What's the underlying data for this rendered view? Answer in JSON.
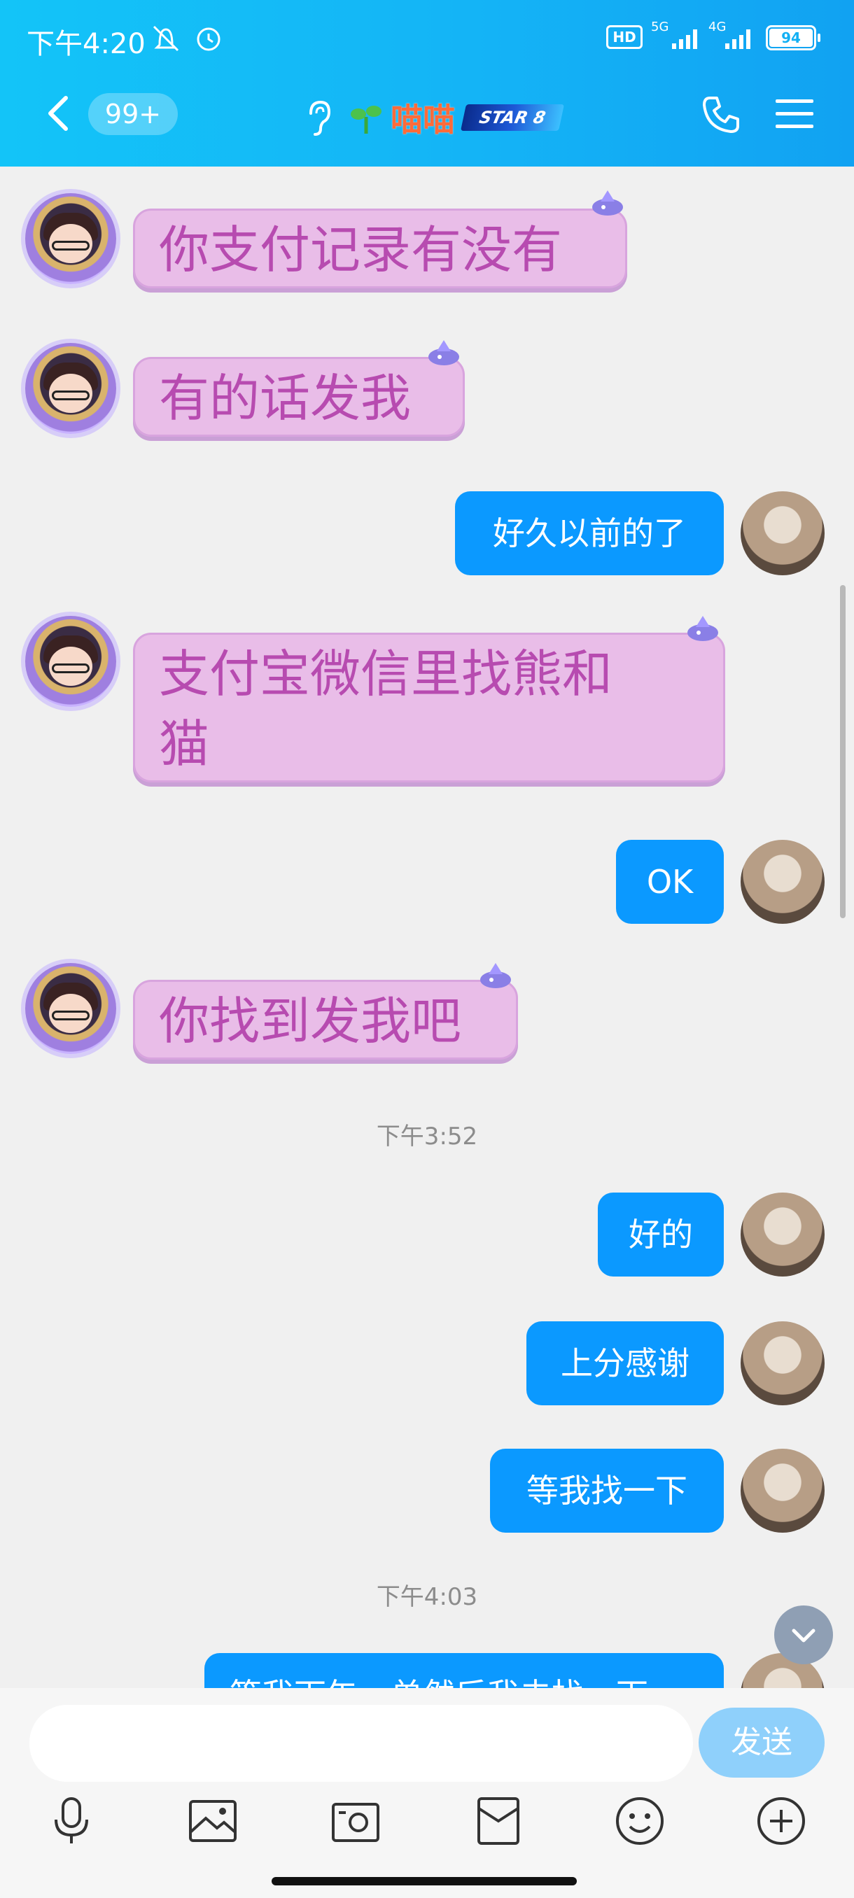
{
  "status_bar": {
    "time": "下午4:20",
    "network_5g": "5G",
    "network_4g": "4G",
    "hd": "HD",
    "battery": "94"
  },
  "header": {
    "unread_badge": "99+",
    "contact_name": "喵喵",
    "level_badge": "STAR 8"
  },
  "messages": {
    "m1": "你支付记录有没有",
    "m2": "有的话发我",
    "m3": "好久以前的了",
    "m4_line1": "支付宝微信里找熊和",
    "m4_line2": "猫",
    "m5": "OK",
    "m6": "你找到发我吧",
    "t1": "下午3:52",
    "m7": "好的",
    "m8": "上分感谢",
    "m9": "等我找一下",
    "t2": "下午4:03",
    "m10": "等我下午，单然后我去找一下"
  },
  "input": {
    "placeholder": "",
    "send_label": "发送"
  },
  "colors": {
    "header": "#13c4f8",
    "bubble_blue": "#0b99ff",
    "bubble_pink": "#e9bde8",
    "pink_text": "#b74bb0"
  },
  "icons": [
    "back-icon",
    "ear-icon",
    "sprout-icon",
    "phone-icon",
    "menu-icon",
    "mic-icon",
    "image-icon",
    "camera-icon",
    "red-packet-icon",
    "emoji-icon",
    "plus-icon",
    "chevron-down-icon"
  ]
}
